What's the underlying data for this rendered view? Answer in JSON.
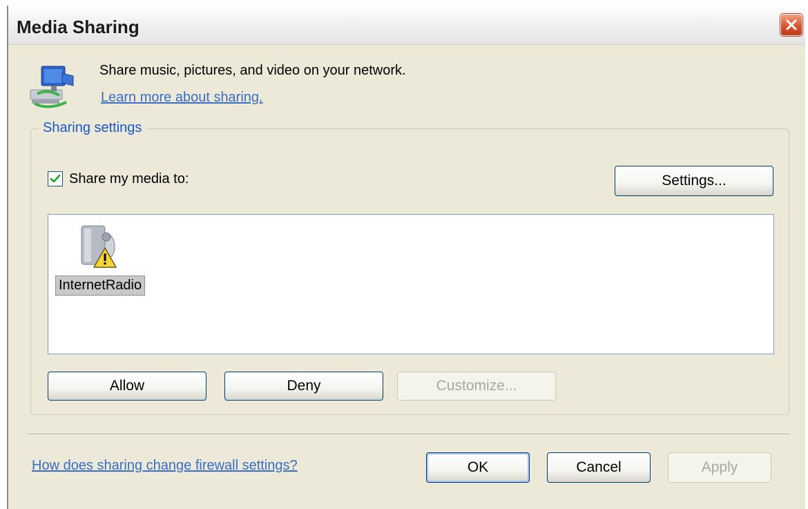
{
  "window": {
    "title": "Media Sharing"
  },
  "intro": {
    "text": "Share music, pictures, and video on your network.",
    "learn_more_link": "Learn more about sharing."
  },
  "sharing_settings": {
    "legend": "Sharing settings",
    "share_checkbox": {
      "label": "Share my media to:",
      "checked": true
    },
    "settings_button": "Settings...",
    "devices": [
      {
        "name": "InternetRadio",
        "icon": "media-device-warning-icon",
        "selected": true
      }
    ],
    "buttons": {
      "allow": "Allow",
      "deny": "Deny",
      "customize": "Customize..."
    }
  },
  "footer": {
    "firewall_link": "How does sharing change firewall settings?",
    "ok": "OK",
    "cancel": "Cancel",
    "apply": "Apply"
  },
  "colors": {
    "dialog_background": "#ece9d8",
    "link": "#3b6ec2",
    "group_legend": "#1c56c8",
    "close_button": "#d9542d",
    "button_border": "#003c74"
  }
}
